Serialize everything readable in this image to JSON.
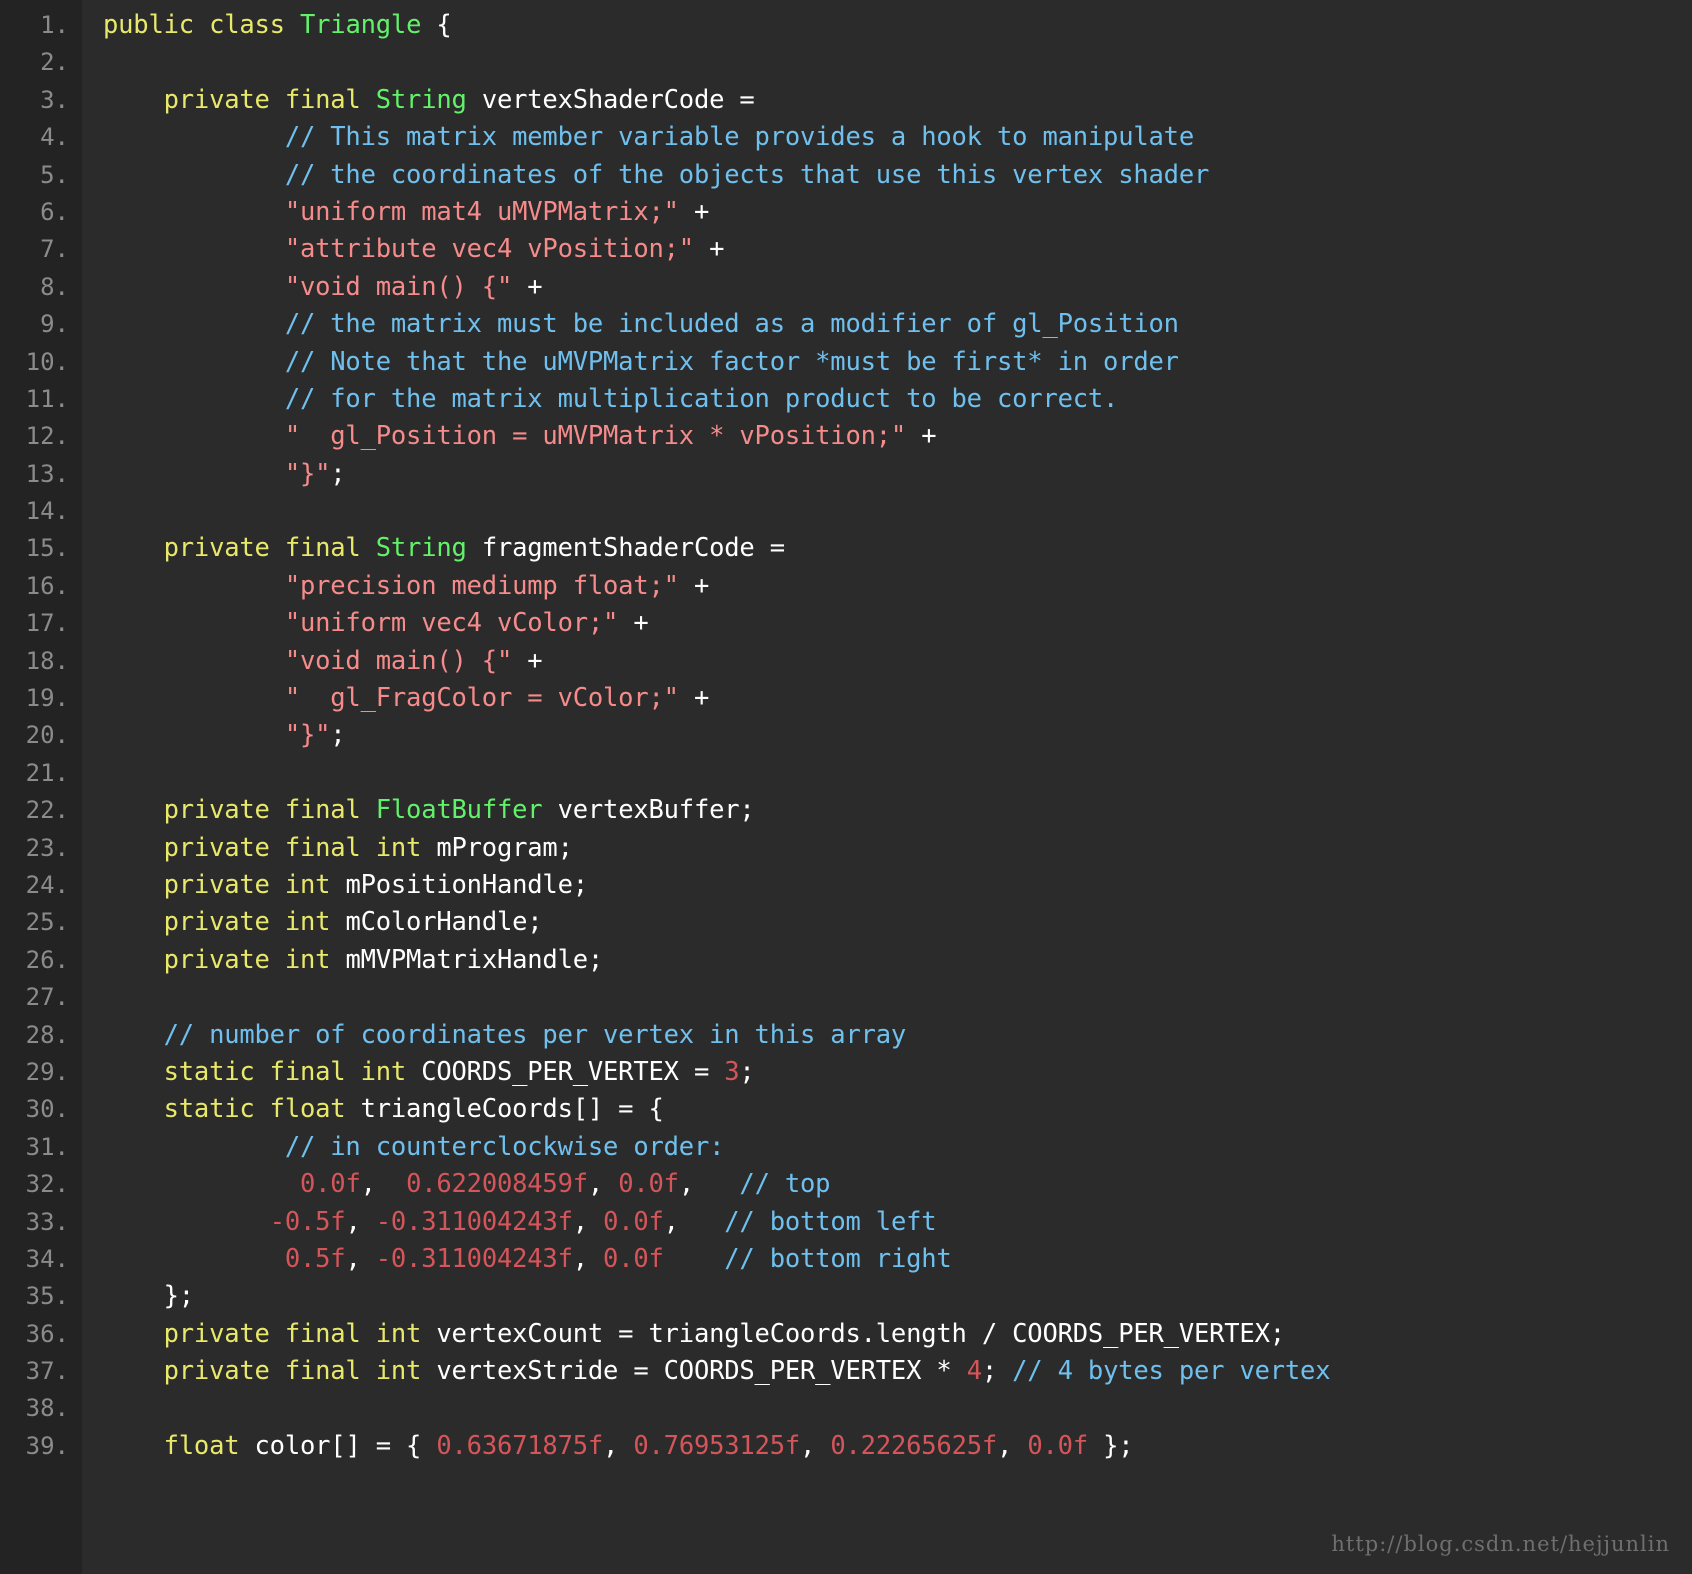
{
  "editor": {
    "background": "#2b2b2b",
    "gutter_background": "#232323",
    "line_number_color": "#8b8b8b",
    "language": "Java",
    "first_line": 1,
    "last_line": 39,
    "total_lines_shown": 39
  },
  "colors": {
    "keyword": "#e8e86a",
    "type": "#62f26a",
    "string": "#f58b8b",
    "comment": "#6fc0ee",
    "number": "#d4555a",
    "plain": "#ffffff"
  },
  "watermark": {
    "text": "http://blog.csdn.net/hejjunlin"
  },
  "lines": [
    {
      "n": "1.",
      "tokens": [
        {
          "t": "public ",
          "c": "kw"
        },
        {
          "t": "class ",
          "c": "kw"
        },
        {
          "t": "Triangle",
          "c": "type"
        },
        {
          "t": " {",
          "c": "plain"
        }
      ]
    },
    {
      "n": "2.",
      "tokens": []
    },
    {
      "n": "3.",
      "tokens": [
        {
          "t": "    ",
          "c": "plain"
        },
        {
          "t": "private final ",
          "c": "kw"
        },
        {
          "t": "String",
          "c": "type"
        },
        {
          "t": " vertexShaderCode =",
          "c": "plain"
        }
      ]
    },
    {
      "n": "4.",
      "tokens": [
        {
          "t": "            ",
          "c": "plain"
        },
        {
          "t": "// This matrix member variable provides a hook to manipulate",
          "c": "cmt"
        }
      ]
    },
    {
      "n": "5.",
      "tokens": [
        {
          "t": "            ",
          "c": "plain"
        },
        {
          "t": "// the coordinates of the objects that use this vertex shader",
          "c": "cmt"
        }
      ]
    },
    {
      "n": "6.",
      "tokens": [
        {
          "t": "            ",
          "c": "plain"
        },
        {
          "t": "\"uniform mat4 uMVPMatrix;\"",
          "c": "str"
        },
        {
          "t": " +",
          "c": "plain"
        }
      ]
    },
    {
      "n": "7.",
      "tokens": [
        {
          "t": "            ",
          "c": "plain"
        },
        {
          "t": "\"attribute vec4 vPosition;\"",
          "c": "str"
        },
        {
          "t": " +",
          "c": "plain"
        }
      ]
    },
    {
      "n": "8.",
      "tokens": [
        {
          "t": "            ",
          "c": "plain"
        },
        {
          "t": "\"void main() {\"",
          "c": "str"
        },
        {
          "t": " +",
          "c": "plain"
        }
      ]
    },
    {
      "n": "9.",
      "tokens": [
        {
          "t": "            ",
          "c": "plain"
        },
        {
          "t": "// the matrix must be included as a modifier of gl_Position",
          "c": "cmt"
        }
      ]
    },
    {
      "n": "10.",
      "tokens": [
        {
          "t": "            ",
          "c": "plain"
        },
        {
          "t": "// Note that the uMVPMatrix factor *must be first* in order",
          "c": "cmt"
        }
      ]
    },
    {
      "n": "11.",
      "tokens": [
        {
          "t": "            ",
          "c": "plain"
        },
        {
          "t": "// for the matrix multiplication product to be correct.",
          "c": "cmt"
        }
      ]
    },
    {
      "n": "12.",
      "tokens": [
        {
          "t": "            ",
          "c": "plain"
        },
        {
          "t": "\"  gl_Position = uMVPMatrix * vPosition;\"",
          "c": "str"
        },
        {
          "t": " +",
          "c": "plain"
        }
      ]
    },
    {
      "n": "13.",
      "tokens": [
        {
          "t": "            ",
          "c": "plain"
        },
        {
          "t": "\"}\"",
          "c": "str"
        },
        {
          "t": ";",
          "c": "plain"
        }
      ]
    },
    {
      "n": "14.",
      "tokens": []
    },
    {
      "n": "15.",
      "tokens": [
        {
          "t": "    ",
          "c": "plain"
        },
        {
          "t": "private final ",
          "c": "kw"
        },
        {
          "t": "String",
          "c": "type"
        },
        {
          "t": " fragmentShaderCode =",
          "c": "plain"
        }
      ]
    },
    {
      "n": "16.",
      "tokens": [
        {
          "t": "            ",
          "c": "plain"
        },
        {
          "t": "\"precision mediump float;\"",
          "c": "str"
        },
        {
          "t": " +",
          "c": "plain"
        }
      ]
    },
    {
      "n": "17.",
      "tokens": [
        {
          "t": "            ",
          "c": "plain"
        },
        {
          "t": "\"uniform vec4 vColor;\"",
          "c": "str"
        },
        {
          "t": " +",
          "c": "plain"
        }
      ]
    },
    {
      "n": "18.",
      "tokens": [
        {
          "t": "            ",
          "c": "plain"
        },
        {
          "t": "\"void main() {\"",
          "c": "str"
        },
        {
          "t": " +",
          "c": "plain"
        }
      ]
    },
    {
      "n": "19.",
      "tokens": [
        {
          "t": "            ",
          "c": "plain"
        },
        {
          "t": "\"  gl_FragColor = vColor;\"",
          "c": "str"
        },
        {
          "t": " +",
          "c": "plain"
        }
      ]
    },
    {
      "n": "20.",
      "tokens": [
        {
          "t": "            ",
          "c": "plain"
        },
        {
          "t": "\"}\"",
          "c": "str"
        },
        {
          "t": ";",
          "c": "plain"
        }
      ]
    },
    {
      "n": "21.",
      "tokens": []
    },
    {
      "n": "22.",
      "tokens": [
        {
          "t": "    ",
          "c": "plain"
        },
        {
          "t": "private final ",
          "c": "kw"
        },
        {
          "t": "FloatBuffer",
          "c": "type"
        },
        {
          "t": " vertexBuffer;",
          "c": "plain"
        }
      ]
    },
    {
      "n": "23.",
      "tokens": [
        {
          "t": "    ",
          "c": "plain"
        },
        {
          "t": "private final int",
          "c": "kw"
        },
        {
          "t": " mProgram;",
          "c": "plain"
        }
      ]
    },
    {
      "n": "24.",
      "tokens": [
        {
          "t": "    ",
          "c": "plain"
        },
        {
          "t": "private int",
          "c": "kw"
        },
        {
          "t": " mPositionHandle;",
          "c": "plain"
        }
      ]
    },
    {
      "n": "25.",
      "tokens": [
        {
          "t": "    ",
          "c": "plain"
        },
        {
          "t": "private int",
          "c": "kw"
        },
        {
          "t": " mColorHandle;",
          "c": "plain"
        }
      ]
    },
    {
      "n": "26.",
      "tokens": [
        {
          "t": "    ",
          "c": "plain"
        },
        {
          "t": "private int",
          "c": "kw"
        },
        {
          "t": " mMVPMatrixHandle;",
          "c": "plain"
        }
      ]
    },
    {
      "n": "27.",
      "tokens": []
    },
    {
      "n": "28.",
      "tokens": [
        {
          "t": "    ",
          "c": "plain"
        },
        {
          "t": "// number of coordinates per vertex in this array",
          "c": "cmt"
        }
      ]
    },
    {
      "n": "29.",
      "tokens": [
        {
          "t": "    ",
          "c": "plain"
        },
        {
          "t": "static final int",
          "c": "kw"
        },
        {
          "t": " COORDS_PER_VERTEX = ",
          "c": "plain"
        },
        {
          "t": "3",
          "c": "num"
        },
        {
          "t": ";",
          "c": "plain"
        }
      ]
    },
    {
      "n": "30.",
      "tokens": [
        {
          "t": "    ",
          "c": "plain"
        },
        {
          "t": "static float",
          "c": "kw"
        },
        {
          "t": " triangleCoords[] = {",
          "c": "plain"
        }
      ]
    },
    {
      "n": "31.",
      "tokens": [
        {
          "t": "            ",
          "c": "plain"
        },
        {
          "t": "// in counterclockwise order:",
          "c": "cmt"
        }
      ]
    },
    {
      "n": "32.",
      "tokens": [
        {
          "t": "             ",
          "c": "plain"
        },
        {
          "t": "0.0f",
          "c": "num"
        },
        {
          "t": ",  ",
          "c": "plain"
        },
        {
          "t": "0.622008459f",
          "c": "num"
        },
        {
          "t": ", ",
          "c": "plain"
        },
        {
          "t": "0.0f",
          "c": "num"
        },
        {
          "t": ",   ",
          "c": "plain"
        },
        {
          "t": "// top",
          "c": "cmt"
        }
      ]
    },
    {
      "n": "33.",
      "tokens": [
        {
          "t": "           ",
          "c": "plain"
        },
        {
          "t": "-0.5f",
          "c": "num"
        },
        {
          "t": ", ",
          "c": "plain"
        },
        {
          "t": "-0.311004243f",
          "c": "num"
        },
        {
          "t": ", ",
          "c": "plain"
        },
        {
          "t": "0.0f",
          "c": "num"
        },
        {
          "t": ",   ",
          "c": "plain"
        },
        {
          "t": "// bottom left",
          "c": "cmt"
        }
      ]
    },
    {
      "n": "34.",
      "tokens": [
        {
          "t": "            ",
          "c": "plain"
        },
        {
          "t": "0.5f",
          "c": "num"
        },
        {
          "t": ", ",
          "c": "plain"
        },
        {
          "t": "-0.311004243f",
          "c": "num"
        },
        {
          "t": ", ",
          "c": "plain"
        },
        {
          "t": "0.0f",
          "c": "num"
        },
        {
          "t": "    ",
          "c": "plain"
        },
        {
          "t": "// bottom right",
          "c": "cmt"
        }
      ]
    },
    {
      "n": "35.",
      "tokens": [
        {
          "t": "    };",
          "c": "plain"
        }
      ]
    },
    {
      "n": "36.",
      "tokens": [
        {
          "t": "    ",
          "c": "plain"
        },
        {
          "t": "private final int",
          "c": "kw"
        },
        {
          "t": " vertexCount = triangleCoords.length / COORDS_PER_VERTEX;",
          "c": "plain"
        }
      ]
    },
    {
      "n": "37.",
      "tokens": [
        {
          "t": "    ",
          "c": "plain"
        },
        {
          "t": "private final int",
          "c": "kw"
        },
        {
          "t": " vertexStride = COORDS_PER_VERTEX * ",
          "c": "plain"
        },
        {
          "t": "4",
          "c": "num"
        },
        {
          "t": "; ",
          "c": "plain"
        },
        {
          "t": "// 4 bytes per vertex",
          "c": "cmt"
        }
      ]
    },
    {
      "n": "38.",
      "tokens": []
    },
    {
      "n": "39.",
      "tokens": [
        {
          "t": "    ",
          "c": "plain"
        },
        {
          "t": "float",
          "c": "kw"
        },
        {
          "t": " color[] = { ",
          "c": "plain"
        },
        {
          "t": "0.63671875f",
          "c": "num"
        },
        {
          "t": ", ",
          "c": "plain"
        },
        {
          "t": "0.76953125f",
          "c": "num"
        },
        {
          "t": ", ",
          "c": "plain"
        },
        {
          "t": "0.22265625f",
          "c": "num"
        },
        {
          "t": ", ",
          "c": "plain"
        },
        {
          "t": "0.0f",
          "c": "num"
        },
        {
          "t": " };",
          "c": "plain"
        }
      ]
    }
  ],
  "source_code": {
    "class_name": "Triangle",
    "fields": [
      "vertexShaderCode",
      "fragmentShaderCode",
      "vertexBuffer",
      "mProgram",
      "mPositionHandle",
      "mColorHandle",
      "mMVPMatrixHandle",
      "COORDS_PER_VERTEX",
      "triangleCoords",
      "vertexCount",
      "vertexStride",
      "color"
    ],
    "COORDS_PER_VERTEX": 3,
    "vertexStride_multiplier": 4,
    "triangleCoords": [
      {
        "x": "0.0f",
        "y": "0.622008459f",
        "z": "0.0f",
        "label": "top"
      },
      {
        "x": "-0.5f",
        "y": "-0.311004243f",
        "z": "0.0f",
        "label": "bottom left"
      },
      {
        "x": "0.5f",
        "y": "-0.311004243f",
        "z": "0.0f",
        "label": "bottom right"
      }
    ],
    "color_array": [
      "0.63671875f",
      "0.76953125f",
      "0.22265625f",
      "0.0f"
    ]
  }
}
